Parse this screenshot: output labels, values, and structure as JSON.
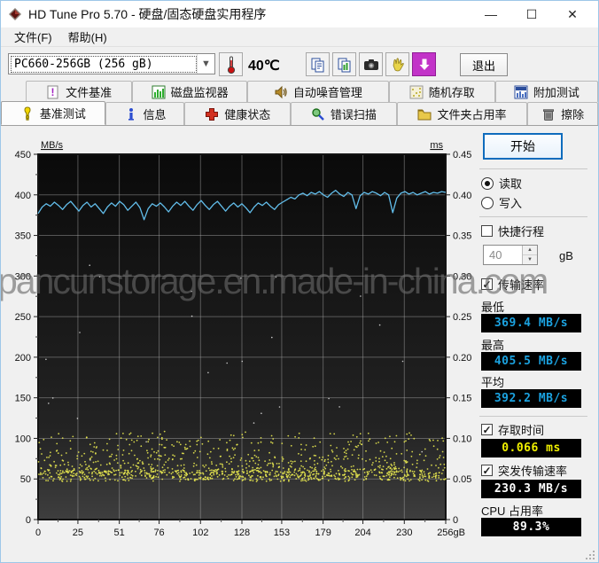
{
  "window": {
    "title": "HD Tune Pro 5.70 - 硬盘/固态硬盘实用程序",
    "controls": {
      "minimize": "—",
      "maximize": "☐",
      "close": "✕"
    }
  },
  "menu": {
    "items": [
      {
        "label": "文件(F)"
      },
      {
        "label": "帮助(H)"
      }
    ]
  },
  "toolbar": {
    "drive_selector": {
      "value": "PC660-256GB  (256 gB)"
    },
    "temperature": "40℃",
    "exit_label": "退出"
  },
  "tabs": {
    "row1": [
      {
        "label": "文件基准"
      },
      {
        "label": "磁盘监视器"
      },
      {
        "label": "自动噪音管理"
      },
      {
        "label": "随机存取"
      },
      {
        "label": "附加测试"
      }
    ],
    "row2": [
      {
        "label": "基准测试",
        "active": true
      },
      {
        "label": "信息"
      },
      {
        "label": "健康状态"
      },
      {
        "label": "错误扫描"
      },
      {
        "label": "文件夹占用率"
      },
      {
        "label": "擦除"
      }
    ]
  },
  "side_panel": {
    "start_button": "开始",
    "read_radio": "读取",
    "write_radio": "写入",
    "short_stroke_checkbox": "快捷行程",
    "short_stroke_value": "40",
    "short_stroke_unit": "gB",
    "transfer_rate_checkbox": "传输速率",
    "check_glyph": "✓",
    "min_label": "最低",
    "min_value": "369.4 MB/s",
    "max_label": "最高",
    "max_value": "405.5 MB/s",
    "avg_label": "平均",
    "avg_value": "392.2 MB/s",
    "access_time_checkbox": "存取时间",
    "access_time_value": "0.066 ms",
    "burst_rate_checkbox": "突发传输速率",
    "burst_rate_value": "230.3 MB/s",
    "cpu_usage_label": "CPU 占用率",
    "cpu_usage_value": "89.3%"
  },
  "watermark": "pancunstorage.en.made-in-china.com",
  "chart_data": {
    "type": "line+scatter",
    "title": "",
    "x_axis": {
      "max": 256,
      "tick_values": [
        0,
        25,
        51,
        76,
        102,
        128,
        153,
        179,
        204,
        230,
        256
      ],
      "tick_labels": [
        "0",
        "25",
        "51",
        "76",
        "102",
        "128",
        "153",
        "179",
        "204",
        "230",
        "256gB"
      ]
    },
    "left_axis": {
      "label": "MB/s",
      "min": 0,
      "max": 450,
      "tick_step": 50
    },
    "right_axis": {
      "label": "ms",
      "min": 0,
      "max": 0.45,
      "tick_step": 0.05
    },
    "grid": true,
    "legend": "none",
    "series": [
      {
        "name": "transfer-rate-line",
        "color": "#62bdea",
        "unit": "MB/s",
        "summary": {
          "min": 369.4,
          "max": 405.5,
          "avg": 392.2
        },
        "y_mbps": [
          377,
          385,
          389,
          386,
          391,
          387,
          382,
          388,
          392,
          386,
          380,
          387,
          391,
          385,
          389,
          383,
          377,
          385,
          390,
          386,
          392,
          388,
          381,
          386,
          391,
          384,
          369.4,
          383,
          389,
          386,
          390,
          385,
          379,
          386,
          391,
          387,
          392,
          386,
          381,
          388,
          393,
          387,
          382,
          388,
          392,
          386,
          380,
          386,
          390,
          385,
          389,
          384,
          378,
          385,
          390,
          387,
          391,
          386,
          382,
          388,
          391,
          394,
          397,
          395,
          400,
          402,
          399,
          403,
          401,
          404,
          400,
          397,
          402,
          405.5,
          401,
          398,
          403,
          400,
          383,
          399,
          403,
          401,
          404,
          402,
          399,
          403,
          400,
          378,
          396,
          402,
          404,
          401,
          403,
          400,
          402,
          404,
          401,
          403,
          402,
          404,
          403
        ]
      },
      {
        "name": "access-time-dots",
        "color": "#e8e850",
        "unit": "ms",
        "typical_ms": 0.066,
        "band_min_ms": 0.047,
        "band_max_ms": 0.112,
        "count": 1250,
        "seed": 9
      },
      {
        "name": "stray-white-dots",
        "color": "#e8e8e8",
        "unit": "ms",
        "min_ms": 0.07,
        "max_ms": 0.34,
        "count": 26,
        "seed": 4
      }
    ]
  }
}
